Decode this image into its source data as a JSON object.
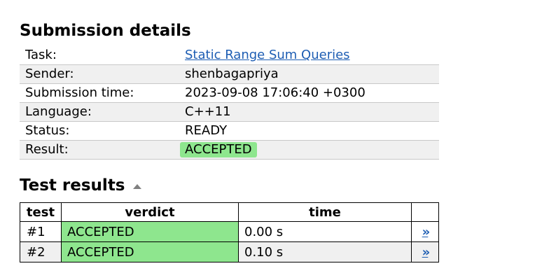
{
  "submission": {
    "heading": "Submission details",
    "rows": [
      {
        "label": "Task:",
        "value": "Static Range Sum Queries"
      },
      {
        "label": "Sender:",
        "value": "shenbagapriya"
      },
      {
        "label": "Submission time:",
        "value": "2023-09-08 17:06:40 +0300"
      },
      {
        "label": "Language:",
        "value": "C++11"
      },
      {
        "label": "Status:",
        "value": "READY"
      },
      {
        "label": "Result:",
        "value": "ACCEPTED"
      }
    ]
  },
  "tests": {
    "heading": "Test results",
    "sort_icon": "triangle-up-icon",
    "columns": [
      "test",
      "verdict",
      "time"
    ],
    "rows": [
      {
        "test": "#1",
        "verdict": "ACCEPTED",
        "time": "0.00 s",
        "link": "»"
      },
      {
        "test": "#2",
        "verdict": "ACCEPTED",
        "time": "0.10 s",
        "link": "»"
      }
    ]
  },
  "colors": {
    "accepted": "#8ee68e",
    "link": "#1d5db3",
    "row_alt": "#f0f0f0"
  }
}
